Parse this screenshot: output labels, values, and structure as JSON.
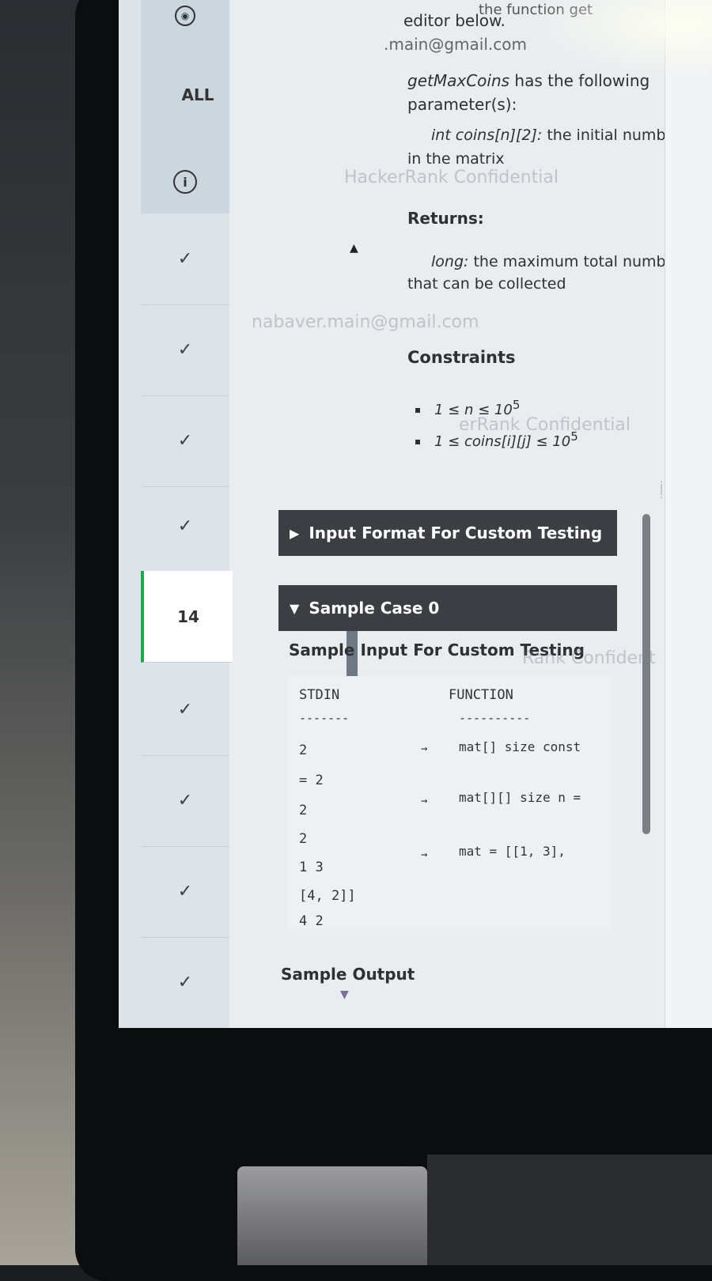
{
  "rail": {
    "all_label": "ALL",
    "info_icon_glyph": "i",
    "check_glyph": "✓",
    "active_question": "14"
  },
  "problem": {
    "header_fragment": "the function get",
    "editor_fragment": "editor below.",
    "email_fragment": ".main@gmail.com",
    "func_name": "getMaxCoins",
    "func_desc": " has the following",
    "params_label": "parameter(s):",
    "param_type": "int coins[n][2]:",
    "param_desc": " the initial number of coins",
    "param_desc2": "in the matrix",
    "returns_label": "Returns:",
    "return_type": "long:",
    "return_desc": " the maximum total number of coins",
    "return_desc2": "that can be collected",
    "constraints_label": "Constraints",
    "constraint_1": "1 ≤ n ≤ 10",
    "constraint_1_exp": "5",
    "constraint_2": "1 ≤ coins[i][j] ≤ 10",
    "constraint_2_exp": "5"
  },
  "sections": {
    "input_format": "Input Format For Custom Testing",
    "sample_case": "Sample Case 0",
    "sample_input_label": "Sample Input For Custom Testing",
    "sample_output_label": "Sample Output"
  },
  "sample": {
    "col_stdin": "STDIN",
    "col_function": "FUNCTION",
    "dash_stdin": "-------",
    "dash_function": "----------",
    "arrow": "→",
    "rows": [
      {
        "stdin": "2",
        "func": "mat[] size const"
      },
      {
        "stdin": "= 2",
        "func": ""
      },
      {
        "stdin": "2",
        "func": "mat[][] size n ="
      },
      {
        "stdin": "2",
        "func": ""
      },
      {
        "stdin": "1 3",
        "func": "mat = [[1, 3],"
      },
      {
        "stdin": "[4, 2]]",
        "func": ""
      },
      {
        "stdin": "4 2",
        "func": ""
      }
    ]
  },
  "watermarks": {
    "w1": "HackerRank Confidential",
    "w2": "nabaver.main@gmail.com",
    "w3": "erRank Confidential",
    "w4": "Rank Confident"
  },
  "colors": {
    "bar_bg": "#3b3e42",
    "active_accent": "#1ba94c",
    "text": "#2c3136"
  }
}
